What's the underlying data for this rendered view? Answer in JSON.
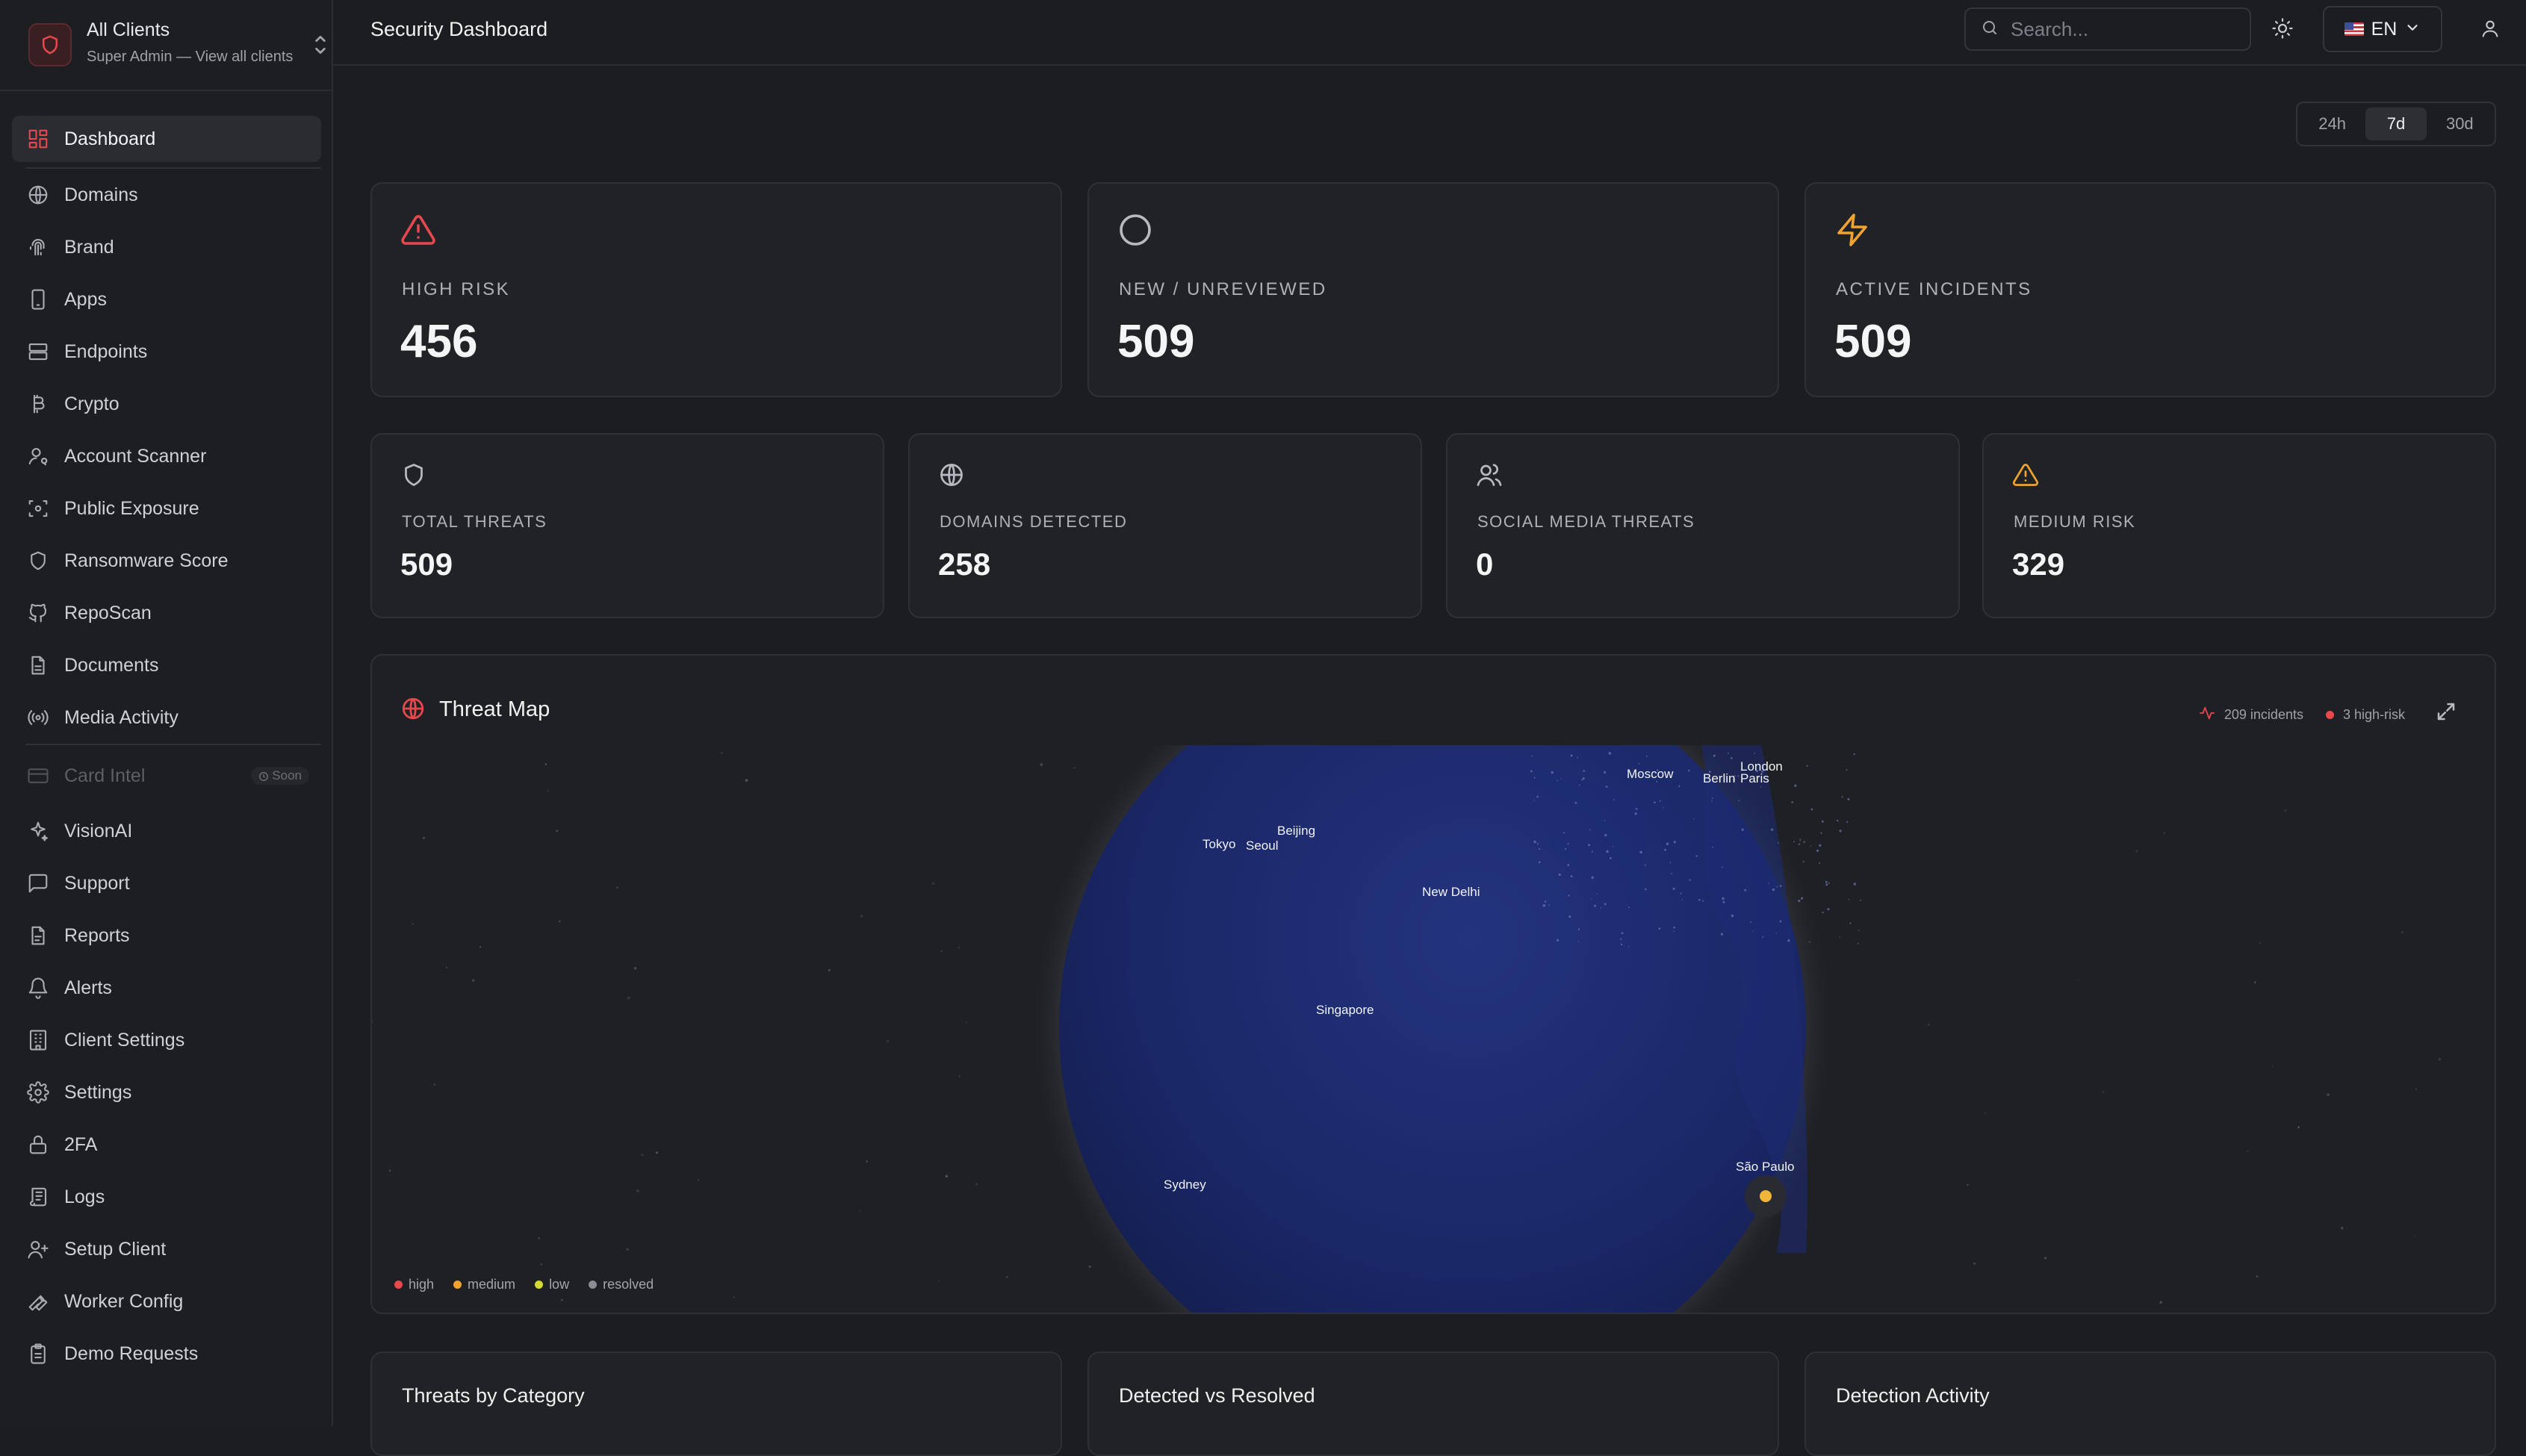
{
  "client_switcher": {
    "name": "All Clients",
    "subtitle": "Super Admin — View all clients"
  },
  "sidebar": {
    "items": [
      {
        "label": "Dashboard",
        "icon": "dashboard-icon",
        "active": true
      },
      {
        "label": "Domains",
        "icon": "globe-icon"
      },
      {
        "label": "Brand",
        "icon": "fingerprint-icon"
      },
      {
        "label": "Apps",
        "icon": "smartphone-icon"
      },
      {
        "label": "Endpoints",
        "icon": "server-icon"
      },
      {
        "label": "Crypto",
        "icon": "bitcoin-icon"
      },
      {
        "label": "Account Scanner",
        "icon": "user-search-icon"
      },
      {
        "label": "Public Exposure",
        "icon": "scan-eye-icon"
      },
      {
        "label": "Ransomware Score",
        "icon": "shield-icon"
      },
      {
        "label": "RepoScan",
        "icon": "github-icon"
      },
      {
        "label": "Documents",
        "icon": "file-text-icon"
      },
      {
        "label": "Media Activity",
        "icon": "radio-icon"
      },
      {
        "label": "Card Intel",
        "icon": "credit-card-icon",
        "disabled": true,
        "badge": "Soon"
      },
      {
        "label": "VisionAI",
        "icon": "sparkles-icon"
      },
      {
        "label": "Support",
        "icon": "message-square-icon"
      },
      {
        "label": "Reports",
        "icon": "file-icon"
      },
      {
        "label": "Alerts",
        "icon": "bell-icon"
      },
      {
        "label": "Client Settings",
        "icon": "building-icon"
      },
      {
        "label": "Settings",
        "icon": "gear-icon"
      },
      {
        "label": "2FA",
        "icon": "lock-icon"
      },
      {
        "label": "Logs",
        "icon": "scroll-icon"
      },
      {
        "label": "Setup Client",
        "icon": "user-plus-icon"
      },
      {
        "label": "Worker Config",
        "icon": "wrench-icon"
      },
      {
        "label": "Demo Requests",
        "icon": "clipboard-icon"
      }
    ]
  },
  "header": {
    "title": "Security Dashboard",
    "search_placeholder": "Search...",
    "language": "EN"
  },
  "time_range": {
    "options": [
      "24h",
      "7d",
      "30d"
    ],
    "selected": "7d"
  },
  "stats_primary": [
    {
      "label": "HIGH RISK",
      "value": "456",
      "icon": "alert-triangle-icon",
      "color": "#e5484d"
    },
    {
      "label": "NEW / UNREVIEWED",
      "value": "509",
      "icon": "circle-icon",
      "color": "#b7bac0"
    },
    {
      "label": "ACTIVE INCIDENTS",
      "value": "509",
      "icon": "zap-icon",
      "color": "#f0a32e"
    }
  ],
  "stats_secondary": [
    {
      "label": "TOTAL THREATS",
      "value": "509",
      "icon": "shield-icon",
      "color": "#b7bac0"
    },
    {
      "label": "DOMAINS DETECTED",
      "value": "258",
      "icon": "globe-icon",
      "color": "#b7bac0"
    },
    {
      "label": "SOCIAL MEDIA THREATS",
      "value": "0",
      "icon": "users-icon",
      "color": "#b7bac0"
    },
    {
      "label": "MEDIUM RISK",
      "value": "329",
      "icon": "alert-triangle-icon",
      "color": "#f0a32e"
    }
  ],
  "threat_map": {
    "title": "Threat Map",
    "incidents_label": "209 incidents",
    "high_risk_label": "3 high-risk",
    "cities": [
      "Moscow",
      "London",
      "Berlin",
      "Paris",
      "Beijing",
      "Tokyo",
      "Seoul",
      "New Delhi",
      "Singapore",
      "São Paulo",
      "Sydney"
    ],
    "legend": [
      {
        "label": "high",
        "color": "#e5484d"
      },
      {
        "label": "medium",
        "color": "#f0a32e"
      },
      {
        "label": "low",
        "color": "#d6d930"
      },
      {
        "label": "resolved",
        "color": "#8a8d94"
      }
    ]
  },
  "bottom_cards": [
    {
      "title": "Threats by Category"
    },
    {
      "title": "Detected vs Resolved"
    },
    {
      "title": "Detection Activity"
    }
  ]
}
